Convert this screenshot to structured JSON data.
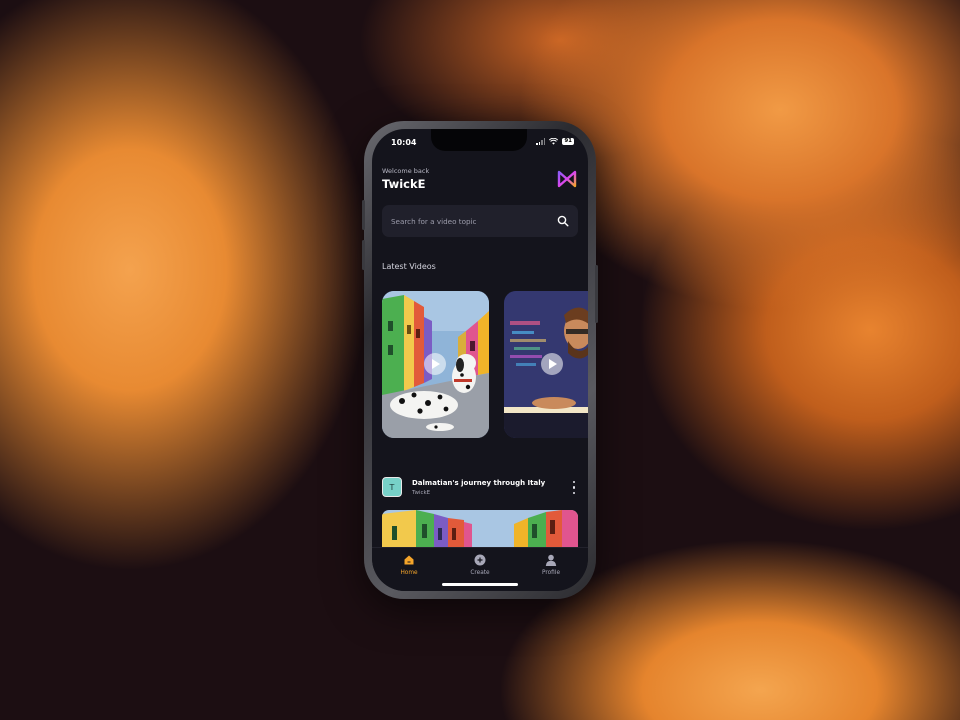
{
  "status_bar": {
    "time": "10:04",
    "battery": "91"
  },
  "header": {
    "welcome": "Welcome back",
    "username": "TwickE"
  },
  "search": {
    "placeholder": "Search for a video topic"
  },
  "latest": {
    "title": "Latest Videos"
  },
  "featured_video": {
    "avatar_letter": "T",
    "title": "Dalmatian's journey through Italy",
    "channel": "TwickE"
  },
  "tabs": [
    {
      "label": "Home",
      "icon": "home-icon",
      "active": true
    },
    {
      "label": "Create",
      "icon": "plus-circle-icon",
      "active": false
    },
    {
      "label": "Profile",
      "icon": "user-icon",
      "active": false
    }
  ],
  "colors": {
    "accent": "#f5a52a",
    "background": "#14141c",
    "surface": "#20202b"
  }
}
